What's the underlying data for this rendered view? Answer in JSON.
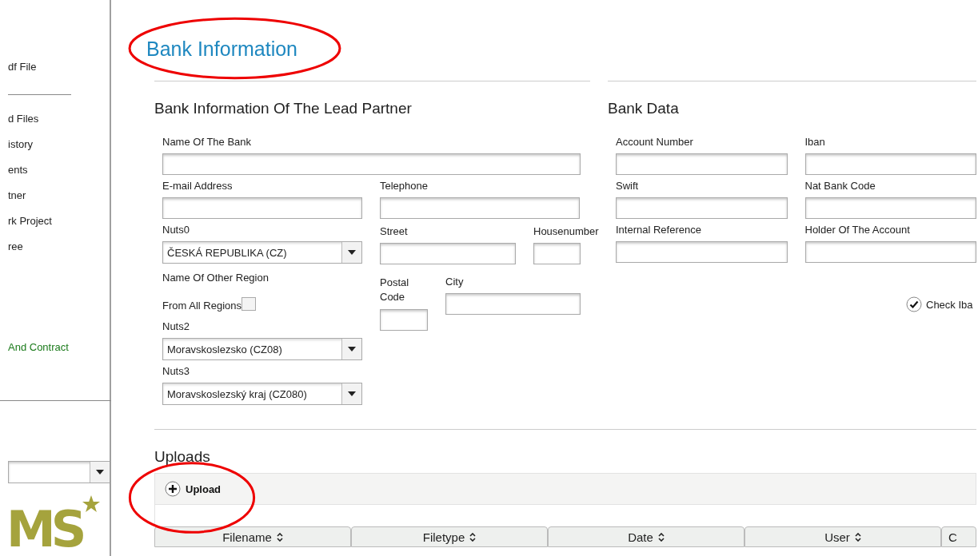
{
  "sidebar": {
    "top_items": [
      {
        "text": "df File"
      }
    ],
    "items": [
      {
        "text": "d Files"
      },
      {
        "text": "istory"
      },
      {
        "text": "ents"
      },
      {
        "text": "tner"
      },
      {
        "text": "rk Project"
      },
      {
        "text": "ree"
      }
    ],
    "bottom_items": [
      {
        "text": "And Contract",
        "color": "#1a7a1a"
      }
    ],
    "logo": {
      "text": "MS"
    }
  },
  "title": {
    "text": "Bank Information",
    "circled": true
  },
  "lead_partner": {
    "heading": "Bank Information Of The Lead Partner",
    "name_of_bank": {
      "label": "Name Of The Bank"
    },
    "email": {
      "label": "E-mail Address"
    },
    "telephone": {
      "label": "Telephone"
    },
    "nuts0": {
      "label": "Nuts0",
      "value": "ČESKÁ REPUBLIKA (CZ)"
    },
    "other_region": {
      "label": "Name Of Other Region"
    },
    "all_regions": {
      "label": "From All Regions",
      "checked": false
    },
    "nuts2": {
      "label": "Nuts2",
      "value": "Moravskoslezsko (CZ08)"
    },
    "nuts3": {
      "label": "Nuts3",
      "value": "Moravskoslezský kraj (CZ080)"
    },
    "street": {
      "label": "Street"
    },
    "housenumber": {
      "label": "Housenumber"
    },
    "postal_code": {
      "label": "Postal Code"
    },
    "city": {
      "label": "City"
    }
  },
  "bank_data": {
    "heading": "Bank Data",
    "account_number": {
      "label": "Account Number"
    },
    "iban": {
      "label": "Iban"
    },
    "swift": {
      "label": "Swift"
    },
    "nat_bank_code": {
      "label": "Nat Bank Code"
    },
    "internal_reference": {
      "label": "Internal Reference"
    },
    "holder": {
      "label": "Holder Of The Account"
    },
    "check_iban": {
      "label": "Check Iba"
    }
  },
  "uploads": {
    "heading": "Uploads",
    "upload_button": {
      "label": "Upload",
      "circled": true
    },
    "table": {
      "columns": [
        "Filename",
        "Filetype",
        "Date",
        "User",
        "C"
      ]
    }
  }
}
